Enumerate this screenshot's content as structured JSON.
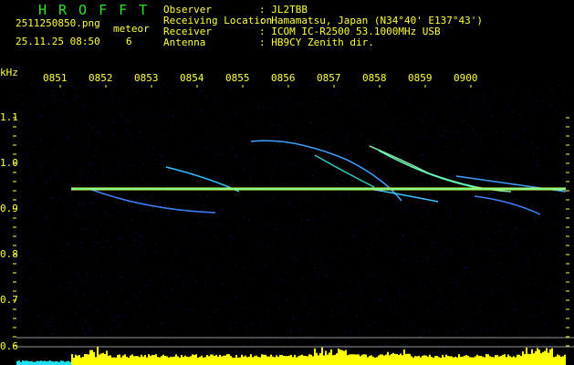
{
  "header": {
    "app_title": "HROFFT",
    "filename": "2511250850.png",
    "datetime": "25.11.25 08:50",
    "mode_label": "meteor",
    "count": "6",
    "info": [
      {
        "label": "Observer",
        "value": ": JL2TBB"
      },
      {
        "label": "Receiving Location",
        "value": ": Hamamatsu, Japan (N34°40' E137°43')"
      },
      {
        "label": "Receiver",
        "value": ": ICOM IC-R2500 53.1000MHz USB"
      },
      {
        "label": "Antenna",
        "value": ": HB9CY Zenith dir."
      }
    ]
  },
  "axis": {
    "y_unit": "kHz",
    "y_ticks": [
      "1.1",
      "1.0",
      "0.9",
      "0.8",
      "0.7",
      "0.6"
    ],
    "x_ticks": [
      "0851",
      "0852",
      "0853",
      "0854",
      "0855",
      "0856",
      "0857",
      "0858",
      "0859",
      "0900"
    ]
  },
  "colors": {
    "text": "#ffff40",
    "title": "#30e030",
    "signal": "#ffff00",
    "noise": "#0a0a50"
  }
}
